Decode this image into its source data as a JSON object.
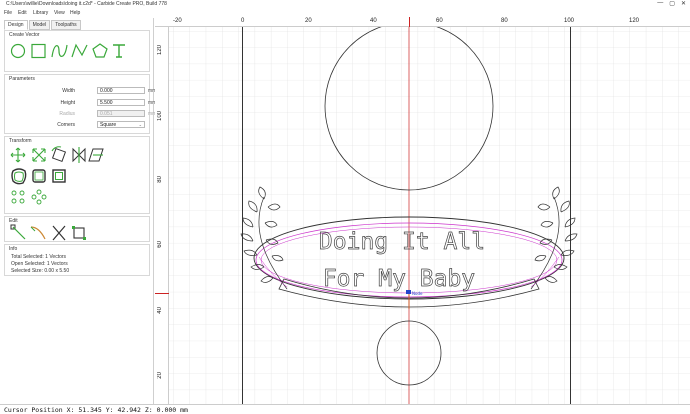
{
  "window": {
    "title": "C:\\Users\\willie\\Downloads\\doing it.c2d* - Carbide Create PRO, Build 778",
    "controls": [
      "—",
      "▢",
      "✕"
    ]
  },
  "menu": {
    "items": [
      "File",
      "Edit",
      "Library",
      "View",
      "Help"
    ]
  },
  "left_panel": {
    "tabs": [
      "Design",
      "Model",
      "Toolpaths"
    ],
    "active_tab": "Design",
    "create_vector": {
      "header": "Create Vector",
      "icons": [
        "circle-icon",
        "rectangle-icon",
        "curve-icon",
        "polyline-icon",
        "polygon-icon",
        "text-icon"
      ]
    },
    "parameters": {
      "header": "Parameters",
      "width": {
        "label": "Width",
        "value": "0.000",
        "unit": "mm"
      },
      "height": {
        "label": "Height",
        "value": "5.500",
        "unit": "mm"
      },
      "radius": {
        "label": "Radius",
        "value": "0.051",
        "unit": "mm"
      },
      "corners": {
        "label": "Corners",
        "value": "Square"
      }
    },
    "transform": {
      "header": "Transform",
      "icons": [
        "move-icon",
        "resize-icon",
        "rotate-icon",
        "mirror-icon",
        "shear-icon",
        "offset-icon",
        "boolean-icon",
        "align-icon",
        "array-icon",
        "circular-array-icon"
      ]
    },
    "edit": {
      "header": "Edit",
      "icons": [
        "node-edit-icon",
        "trim-icon",
        "cut-icon",
        "bounding-box-icon"
      ]
    },
    "info": {
      "header": "Info",
      "total_selected": "Total Selected:  1 Vectors",
      "open_selected": "Open Selected:  1 Vectors",
      "selected_size": "Selected Size:   0.00 x 5.50"
    }
  },
  "canvas": {
    "ruler_top_labels": [
      "-20",
      "0",
      "20",
      "40",
      "60",
      "80",
      "100",
      "120"
    ],
    "ruler_left_labels": [
      "120",
      "100",
      "80",
      "60",
      "40",
      "20"
    ],
    "design_text_line1": "Doing It All",
    "design_text_line2": "For My Baby",
    "node_label": "Node",
    "colors": {
      "grid": "#d9d9d9",
      "axis": "#cc2222",
      "stroke": "#222222",
      "selection": "#cc33cc",
      "node": "#2244cc"
    }
  },
  "status": {
    "cursor": "Cursor Position X: 51.345 Y: 42.942 Z: 0.000 mm"
  }
}
